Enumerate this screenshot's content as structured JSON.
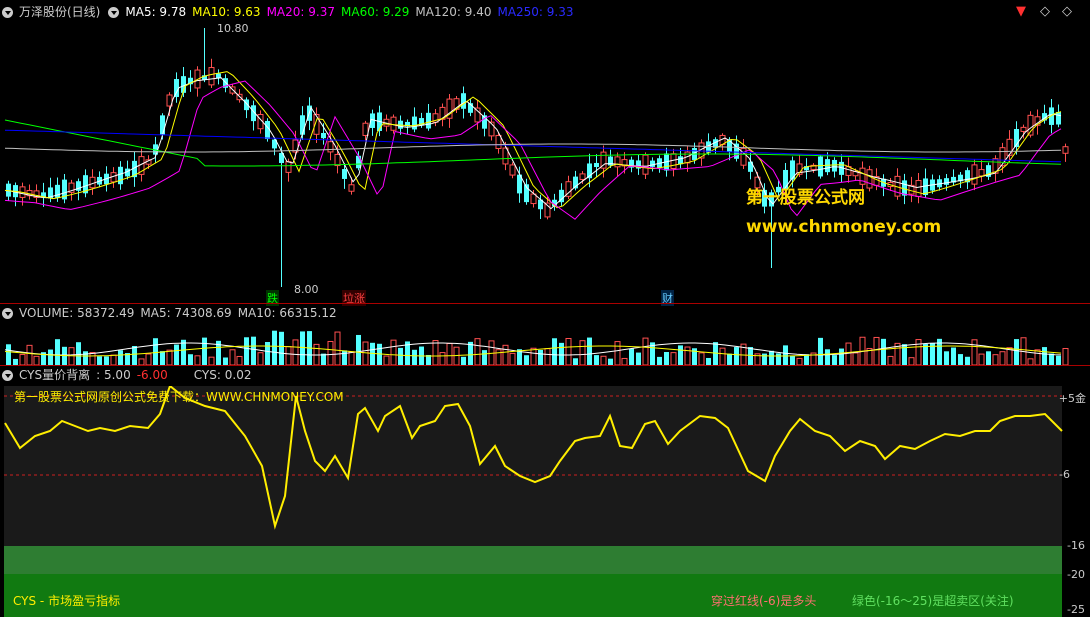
{
  "main_header": {
    "title": "万泽股份(日线)",
    "ma5": "MA5: 9.78",
    "ma10": "MA10: 9.63",
    "ma20": "MA20: 9.37",
    "ma60": "MA60: 9.29",
    "ma120": "MA120: 9.40",
    "ma250": "MA250: 9.33"
  },
  "colors": {
    "ma5": "#ffffff",
    "ma10": "#ffff00",
    "ma20": "#ff00ff",
    "ma60": "#00ff00",
    "ma120": "#c0c0c0",
    "ma250": "#0000ff",
    "up": "#ff5050",
    "down": "#54ffff",
    "cys": "#ffee00"
  },
  "price_labels": {
    "high": "10.80",
    "low": "8.00"
  },
  "event_markers": [
    {
      "label": "跌",
      "color": "#00ff00",
      "bg": "#003300"
    },
    {
      "label": "垃涨",
      "color": "#ff4040",
      "bg": "#330000"
    },
    {
      "label": "财",
      "color": "#66ccff",
      "bg": "#002244"
    }
  ],
  "watermark": {
    "title": "第一股票公式网",
    "url": "www.chnmoney.com"
  },
  "volume_header": {
    "volume": "VOLUME: 58372.49",
    "ma5": "MA5: 74308.69",
    "ma10": "MA10: 66315.12"
  },
  "cys_header": {
    "name": "CYS量价背离",
    "v1": ": 5.00",
    "v2": "-6.00",
    "cys": "CYS: 0.02"
  },
  "cys_panel": {
    "banner": "第一股票公式网原创公式免费下载：WWW.CHNMONEY.COM",
    "y_labels": [
      "+5金",
      "-6",
      "-16",
      "-20",
      "-25"
    ],
    "caption_left": "CYS - 市场盈亏指标",
    "caption_mid": "穿过红线(-6)是多头",
    "caption_right": "绿色(-16～25)是超卖区(关注)"
  },
  "window_controls": {
    "a": "▼",
    "b": "◇",
    "c": "◇"
  }
}
